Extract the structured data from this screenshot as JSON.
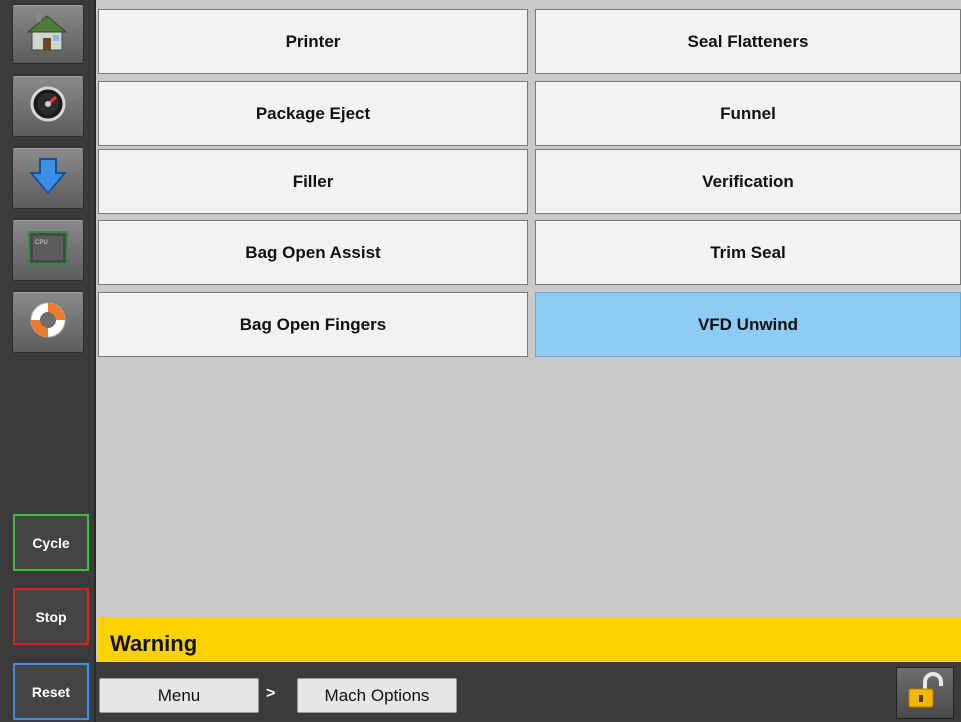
{
  "sidebar": {
    "icons": [
      {
        "name": "home-icon"
      },
      {
        "name": "gauge-icon"
      },
      {
        "name": "download-arrow-icon"
      },
      {
        "name": "cpu-icon",
        "label": "CPU"
      },
      {
        "name": "lifebuoy-icon"
      }
    ],
    "cycle_label": "Cycle",
    "stop_label": "Stop",
    "reset_label": "Reset",
    "colors": {
      "cycle": "#35c235",
      "stop": "#e01f1f",
      "reset": "#3a8ee6"
    }
  },
  "grid": {
    "buttons": [
      {
        "label": "Printer"
      },
      {
        "label": "Seal Flatteners"
      },
      {
        "label": "Package Eject"
      },
      {
        "label": "Funnel"
      },
      {
        "label": "Filler"
      },
      {
        "label": "Verification"
      },
      {
        "label": "Bag Open Assist"
      },
      {
        "label": "Trim Seal"
      },
      {
        "label": "Bag Open Fingers"
      },
      {
        "label": "VFD Unwind",
        "selected": true
      }
    ]
  },
  "warning": {
    "text": "Warning",
    "color": "#fbd100"
  },
  "breadcrumb": {
    "menu_label": "Menu",
    "separator": ">",
    "current_label": "Mach Options"
  },
  "lock": {
    "icon": "unlocked-padlock-icon"
  }
}
